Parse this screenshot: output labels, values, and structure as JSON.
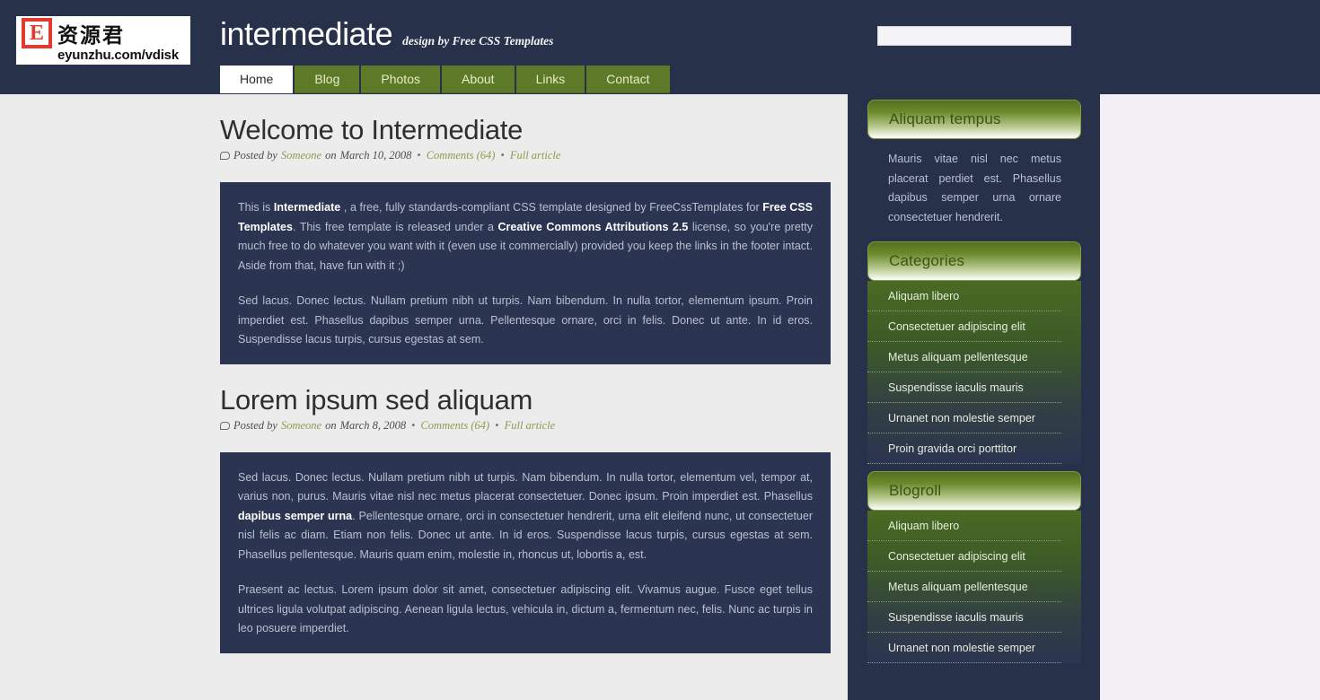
{
  "header": {
    "site_title": "intermediate",
    "tagline": "design by Free CSS Templates",
    "logo": {
      "letter": "E",
      "chinese": "资源君",
      "url": "eyunzhu.com/vdisk"
    },
    "search": {
      "value": "",
      "placeholder": ""
    },
    "nav": [
      {
        "label": "Home",
        "active": true
      },
      {
        "label": "Blog",
        "active": false
      },
      {
        "label": "Photos",
        "active": false
      },
      {
        "label": "About",
        "active": false
      },
      {
        "label": "Links",
        "active": false
      },
      {
        "label": "Contact",
        "active": false
      }
    ]
  },
  "posts": [
    {
      "title": "Welcome to Intermediate",
      "meta": {
        "posted_by_prefix": "Posted by",
        "author": "Someone",
        "date_prefix": "on",
        "date": "March 10, 2008",
        "comments": "Comments (64)",
        "full_article": "Full article",
        "separator": "•"
      },
      "paragraph_1_html": "This is <b>Intermediate</b> , a free, fully standards-compliant CSS template designed by FreeCssTemplates for <a href=\"#\">Free CSS Templates</a>. This free template is released under a <b>Creative Commons Attributions 2.5</b> license, so you're pretty much free to do whatever you want with it (even use it commercially) provided you keep the links in the footer intact. Aside from that, have fun with it ;)",
      "paragraph_2_html": "Sed lacus. Donec lectus. Nullam pretium nibh ut turpis. Nam bibendum. In nulla tortor, elementum ipsum. Proin imperdiet est. Phasellus dapibus semper urna. Pellentesque ornare, orci in felis. Donec ut ante. In id eros. Suspendisse lacus turpis, cursus egestas at sem."
    },
    {
      "title": "Lorem ipsum sed aliquam",
      "meta": {
        "posted_by_prefix": "Posted by",
        "author": "Someone",
        "date_prefix": "on",
        "date": "March 8, 2008",
        "comments": "Comments (64)",
        "full_article": "Full article",
        "separator": "•"
      },
      "paragraph_1_html": "Sed lacus. Donec lectus. Nullam pretium nibh ut turpis. Nam bibendum. In nulla tortor, elementum vel, tempor at, varius non, purus. Mauris vitae nisl nec metus placerat consectetuer. Donec ipsum. Proin imperdiet est. Phasellus <a href=\"#\">dapibus semper urna</a>. Pellentesque ornare, orci in consectetuer hendrerit, urna elit eleifend nunc, ut consectetuer nisl felis ac diam. Etiam non felis. Donec ut ante. In id eros. Suspendisse lacus turpis, cursus egestas at sem. Phasellus pellentesque. Mauris quam enim, molestie in, rhoncus ut, lobortis a, est.",
      "paragraph_2_html": "Praesent ac lectus. Lorem ipsum dolor sit amet, consectetuer adipiscing elit. Vivamus augue. Fusce eget tellus ultrices ligula volutpat adipiscing. Aenean ligula lectus, vehicula in, dictum a, fermentum nec, felis. Nunc ac turpis in leo posuere imperdiet."
    }
  ],
  "sidebar": {
    "widgets": [
      {
        "type": "text",
        "title": "Aliquam tempus",
        "text": "Mauris vitae nisl nec metus placerat perdiet est. Phasellus dapibus semper urna ornare consectetuer hendrerit."
      },
      {
        "type": "list",
        "title": "Categories",
        "items": [
          "Aliquam libero",
          "Consectetuer adipiscing elit",
          "Metus aliquam pellentesque",
          "Suspendisse iaculis mauris",
          "Urnanet non molestie semper",
          "Proin gravida orci porttitor"
        ]
      },
      {
        "type": "list",
        "title": "Blogroll",
        "items": [
          "Aliquam libero",
          "Consectetuer adipiscing elit",
          "Metus aliquam pellentesque",
          "Suspendisse iaculis mauris",
          "Urnanet non molestie semper"
        ]
      }
    ]
  },
  "colors": {
    "header_bg": "#27314a",
    "nav_green": "#5d7a28",
    "panel_navy": "#2b3450",
    "page_bg": "#ececec",
    "accent_olive": "#8d9c4e"
  }
}
